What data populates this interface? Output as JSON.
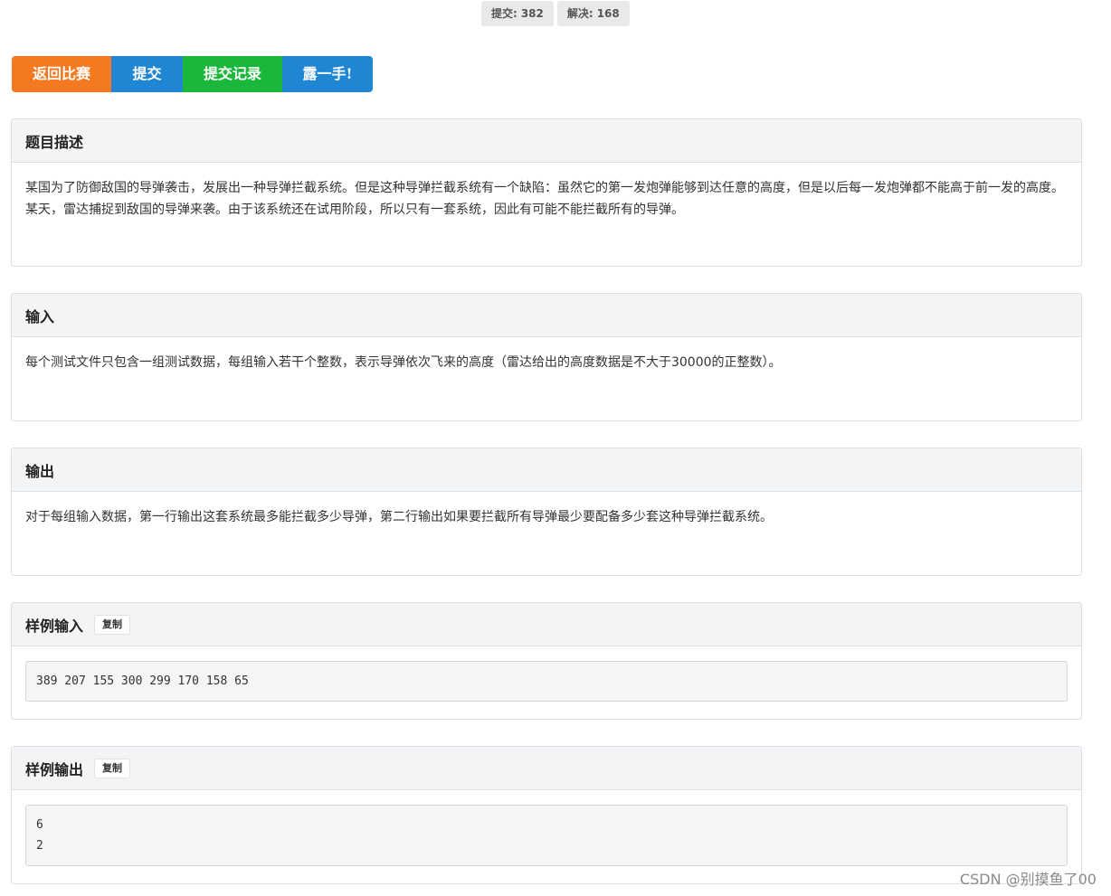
{
  "stats": {
    "submit_label": "提交:",
    "submit_count": "382",
    "solved_label": "解决:",
    "solved_count": "168"
  },
  "actions": {
    "back": "返回比赛",
    "submit": "提交",
    "status": "提交记录",
    "show_off": "露一手!"
  },
  "description": {
    "title": "题目描述",
    "text": "某国为了防御敌国的导弹袭击，发展出一种导弹拦截系统。但是这种导弹拦截系统有一个缺陷：虽然它的第一发炮弹能够到达任意的高度，但是以后每一发炮弹都不能高于前一发的高度。某天，雷达捕捉到敌国的导弹来袭。由于该系统还在试用阶段，所以只有一套系统，因此有可能不能拦截所有的导弹。"
  },
  "input": {
    "title": "输入",
    "text": "每个测试文件只包含一组测试数据，每组输入若干个整数，表示导弹依次飞来的高度（雷达给出的高度数据是不大于30000的正整数）。"
  },
  "output": {
    "title": "输出",
    "text": "对于每组输入数据，第一行输出这套系统最多能拦截多少导弹，第二行输出如果要拦截所有导弹最少要配备多少套这种导弹拦截系统。"
  },
  "sample_input": {
    "title": "样例输入",
    "copy_label": "复制",
    "code": "389 207 155 300 299 170 158 65"
  },
  "sample_output": {
    "title": "样例输出",
    "copy_label": "复制",
    "code": "6\n2"
  },
  "watermark": "CSDN @别摸鱼了00",
  "colors": {
    "back_button": "#f47920",
    "submit_button": "#1e86d3",
    "status_button": "#1ab83a",
    "show_button": "#1e86d3",
    "panel_header": "#f3f4f6"
  }
}
